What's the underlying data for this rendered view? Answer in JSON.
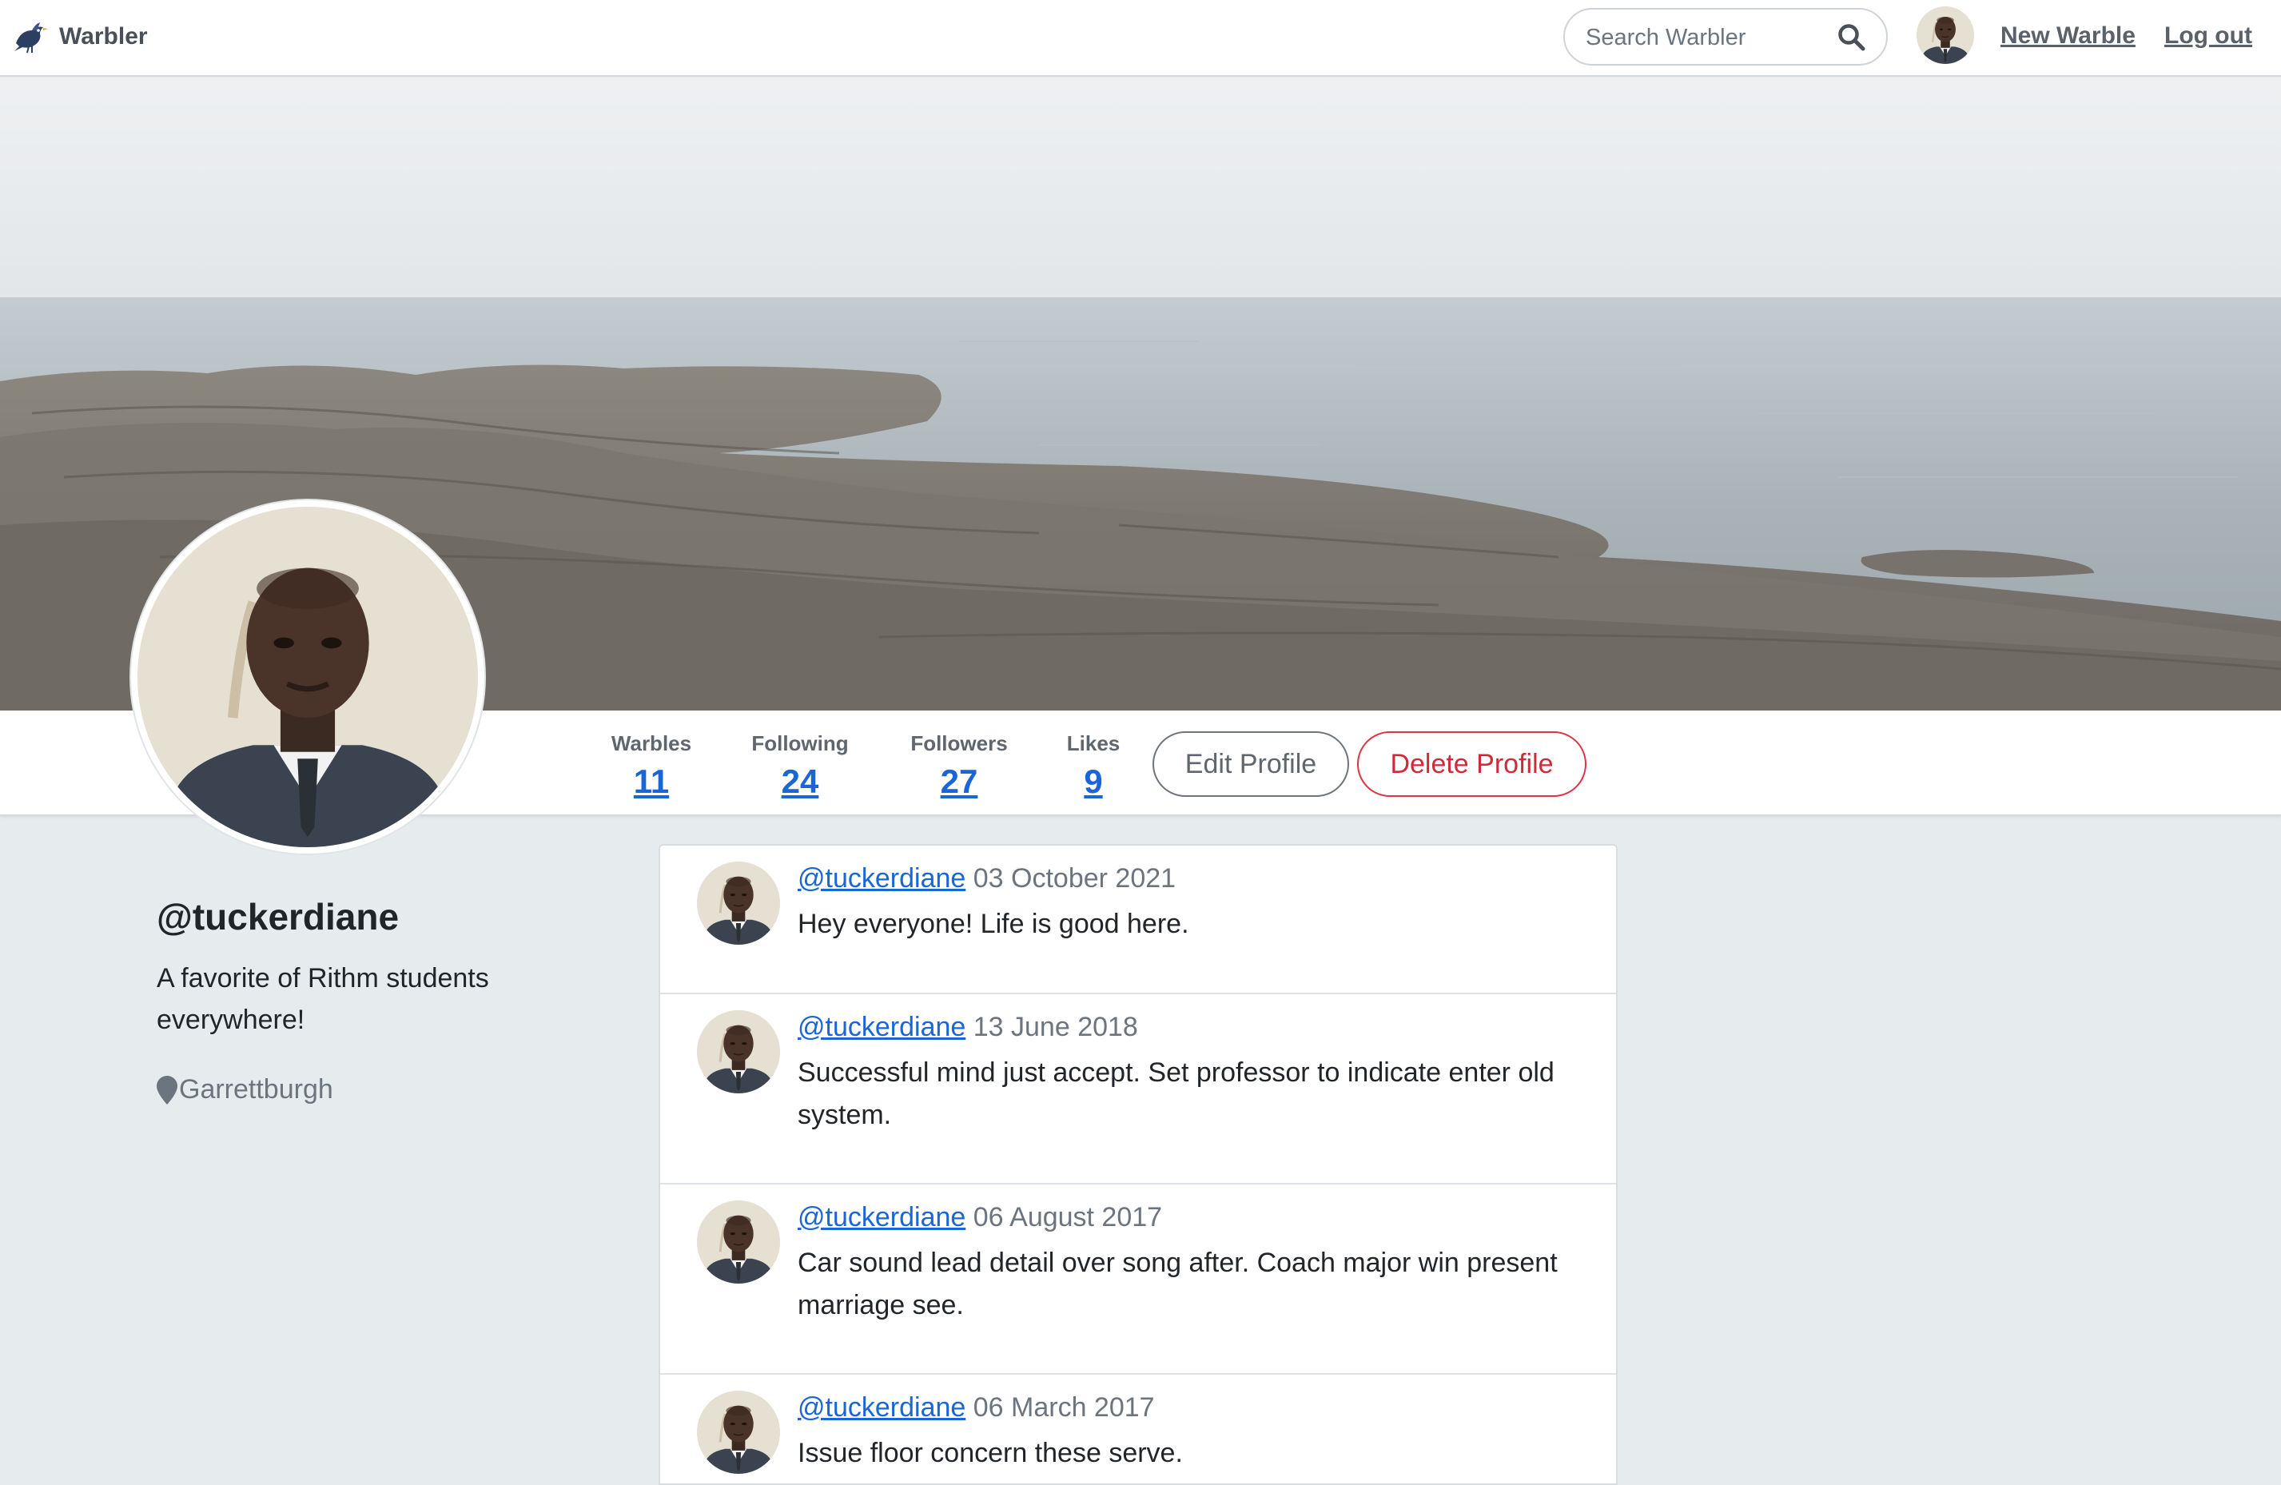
{
  "navbar": {
    "brand": "Warbler",
    "search_placeholder": "Search Warbler",
    "new_warble": "New Warble",
    "logout": "Log out"
  },
  "profile": {
    "username": "@tuckerdiane",
    "bio": "A favorite of Rithm students everywhere!",
    "location": "Garrettburgh",
    "stats": [
      {
        "label": "Warbles",
        "value": "11"
      },
      {
        "label": "Following",
        "value": "24"
      },
      {
        "label": "Followers",
        "value": "27"
      },
      {
        "label": "Likes",
        "value": "9"
      }
    ],
    "edit_label": "Edit Profile",
    "delete_label": "Delete Profile"
  },
  "messages": [
    {
      "user": "@tuckerdiane",
      "date": "03 October 2021",
      "text": "Hey everyone! Life is good here."
    },
    {
      "user": "@tuckerdiane",
      "date": "13 June 2018",
      "text": "Successful mind just accept. Set professor to indicate enter old system."
    },
    {
      "user": "@tuckerdiane",
      "date": "06 August 2017",
      "text": "Car sound lead detail over song after. Coach major win present marriage see."
    },
    {
      "user": "@tuckerdiane",
      "date": "06 March 2017",
      "text": "Issue floor concern these serve."
    }
  ],
  "icons": {
    "logo": "warbler-bird-icon",
    "search": "search-icon",
    "location": "map-pin-icon"
  },
  "colors": {
    "link": "#1a66d6",
    "danger": "#dc3545",
    "page_bg": "#e6ebee"
  }
}
